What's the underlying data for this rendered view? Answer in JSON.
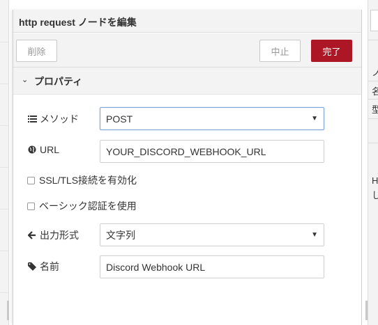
{
  "tray": {
    "title": "http request ノードを編集",
    "delete_label": "削除",
    "cancel_label": "中止",
    "done_label": "完了"
  },
  "properties": {
    "section_label": "プロパティ",
    "method": {
      "label": "メソッド",
      "value": "POST"
    },
    "url": {
      "label": "URL",
      "value": "YOUR_DISCORD_WEBHOOK_URL"
    },
    "ssl": {
      "label": "SSL/TLS接続を有効化",
      "checked": false
    },
    "basic_auth": {
      "label": "ベーシック認証を使用",
      "checked": false
    },
    "output": {
      "label": "出力形式",
      "value": "文字列"
    },
    "name": {
      "label": "名前",
      "value": "Discord Webhook URL"
    }
  },
  "sidebar": {
    "row1": "ノ",
    "row2": "名",
    "row3": "型",
    "row4": "H",
    "row5": "し"
  },
  "colors": {
    "done_button": "#ad1625",
    "panel_bg": "#f3f3f3"
  },
  "icons": {
    "method": "list-icon",
    "url": "globe-icon",
    "output": "arrow-left-icon",
    "name": "tag-icon",
    "section": "chevron-down-icon"
  }
}
